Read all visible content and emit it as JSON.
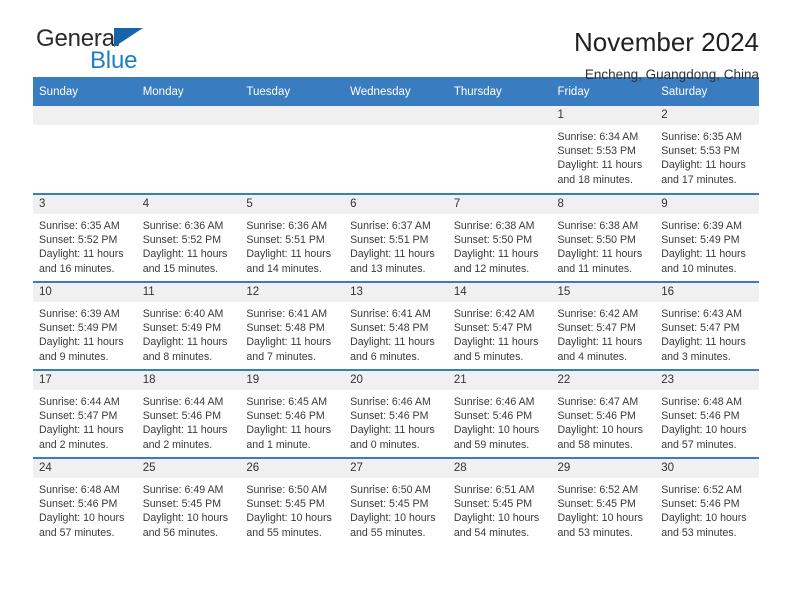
{
  "brand": {
    "name_part1": "General",
    "name_part2": "Blue",
    "mark": "triangle-logo"
  },
  "header": {
    "title": "November 2024",
    "subtitle": "Encheng, Guangdong, China"
  },
  "calendar": {
    "weekday_headers": [
      "Sunday",
      "Monday",
      "Tuesday",
      "Wednesday",
      "Thursday",
      "Friday",
      "Saturday"
    ],
    "colors": {
      "header_blue": "#3a7cc0",
      "daynum_band": "#f0f0f0",
      "brand_blue": "#1f7fc4",
      "text": "#333333"
    },
    "weeks": [
      [
        {
          "empty": true
        },
        {
          "empty": true
        },
        {
          "empty": true
        },
        {
          "empty": true
        },
        {
          "empty": true
        },
        {
          "day": "1",
          "sunrise": "Sunrise: 6:34 AM",
          "sunset": "Sunset: 5:53 PM",
          "daylight": "Daylight: 11 hours and 18 minutes."
        },
        {
          "day": "2",
          "sunrise": "Sunrise: 6:35 AM",
          "sunset": "Sunset: 5:53 PM",
          "daylight": "Daylight: 11 hours and 17 minutes."
        }
      ],
      [
        {
          "day": "3",
          "sunrise": "Sunrise: 6:35 AM",
          "sunset": "Sunset: 5:52 PM",
          "daylight": "Daylight: 11 hours and 16 minutes."
        },
        {
          "day": "4",
          "sunrise": "Sunrise: 6:36 AM",
          "sunset": "Sunset: 5:52 PM",
          "daylight": "Daylight: 11 hours and 15 minutes."
        },
        {
          "day": "5",
          "sunrise": "Sunrise: 6:36 AM",
          "sunset": "Sunset: 5:51 PM",
          "daylight": "Daylight: 11 hours and 14 minutes."
        },
        {
          "day": "6",
          "sunrise": "Sunrise: 6:37 AM",
          "sunset": "Sunset: 5:51 PM",
          "daylight": "Daylight: 11 hours and 13 minutes."
        },
        {
          "day": "7",
          "sunrise": "Sunrise: 6:38 AM",
          "sunset": "Sunset: 5:50 PM",
          "daylight": "Daylight: 11 hours and 12 minutes."
        },
        {
          "day": "8",
          "sunrise": "Sunrise: 6:38 AM",
          "sunset": "Sunset: 5:50 PM",
          "daylight": "Daylight: 11 hours and 11 minutes."
        },
        {
          "day": "9",
          "sunrise": "Sunrise: 6:39 AM",
          "sunset": "Sunset: 5:49 PM",
          "daylight": "Daylight: 11 hours and 10 minutes."
        }
      ],
      [
        {
          "day": "10",
          "sunrise": "Sunrise: 6:39 AM",
          "sunset": "Sunset: 5:49 PM",
          "daylight": "Daylight: 11 hours and 9 minutes."
        },
        {
          "day": "11",
          "sunrise": "Sunrise: 6:40 AM",
          "sunset": "Sunset: 5:49 PM",
          "daylight": "Daylight: 11 hours and 8 minutes."
        },
        {
          "day": "12",
          "sunrise": "Sunrise: 6:41 AM",
          "sunset": "Sunset: 5:48 PM",
          "daylight": "Daylight: 11 hours and 7 minutes."
        },
        {
          "day": "13",
          "sunrise": "Sunrise: 6:41 AM",
          "sunset": "Sunset: 5:48 PM",
          "daylight": "Daylight: 11 hours and 6 minutes."
        },
        {
          "day": "14",
          "sunrise": "Sunrise: 6:42 AM",
          "sunset": "Sunset: 5:47 PM",
          "daylight": "Daylight: 11 hours and 5 minutes."
        },
        {
          "day": "15",
          "sunrise": "Sunrise: 6:42 AM",
          "sunset": "Sunset: 5:47 PM",
          "daylight": "Daylight: 11 hours and 4 minutes."
        },
        {
          "day": "16",
          "sunrise": "Sunrise: 6:43 AM",
          "sunset": "Sunset: 5:47 PM",
          "daylight": "Daylight: 11 hours and 3 minutes."
        }
      ],
      [
        {
          "day": "17",
          "sunrise": "Sunrise: 6:44 AM",
          "sunset": "Sunset: 5:47 PM",
          "daylight": "Daylight: 11 hours and 2 minutes."
        },
        {
          "day": "18",
          "sunrise": "Sunrise: 6:44 AM",
          "sunset": "Sunset: 5:46 PM",
          "daylight": "Daylight: 11 hours and 2 minutes."
        },
        {
          "day": "19",
          "sunrise": "Sunrise: 6:45 AM",
          "sunset": "Sunset: 5:46 PM",
          "daylight": "Daylight: 11 hours and 1 minute."
        },
        {
          "day": "20",
          "sunrise": "Sunrise: 6:46 AM",
          "sunset": "Sunset: 5:46 PM",
          "daylight": "Daylight: 11 hours and 0 minutes."
        },
        {
          "day": "21",
          "sunrise": "Sunrise: 6:46 AM",
          "sunset": "Sunset: 5:46 PM",
          "daylight": "Daylight: 10 hours and 59 minutes."
        },
        {
          "day": "22",
          "sunrise": "Sunrise: 6:47 AM",
          "sunset": "Sunset: 5:46 PM",
          "daylight": "Daylight: 10 hours and 58 minutes."
        },
        {
          "day": "23",
          "sunrise": "Sunrise: 6:48 AM",
          "sunset": "Sunset: 5:46 PM",
          "daylight": "Daylight: 10 hours and 57 minutes."
        }
      ],
      [
        {
          "day": "24",
          "sunrise": "Sunrise: 6:48 AM",
          "sunset": "Sunset: 5:46 PM",
          "daylight": "Daylight: 10 hours and 57 minutes."
        },
        {
          "day": "25",
          "sunrise": "Sunrise: 6:49 AM",
          "sunset": "Sunset: 5:45 PM",
          "daylight": "Daylight: 10 hours and 56 minutes."
        },
        {
          "day": "26",
          "sunrise": "Sunrise: 6:50 AM",
          "sunset": "Sunset: 5:45 PM",
          "daylight": "Daylight: 10 hours and 55 minutes."
        },
        {
          "day": "27",
          "sunrise": "Sunrise: 6:50 AM",
          "sunset": "Sunset: 5:45 PM",
          "daylight": "Daylight: 10 hours and 55 minutes."
        },
        {
          "day": "28",
          "sunrise": "Sunrise: 6:51 AM",
          "sunset": "Sunset: 5:45 PM",
          "daylight": "Daylight: 10 hours and 54 minutes."
        },
        {
          "day": "29",
          "sunrise": "Sunrise: 6:52 AM",
          "sunset": "Sunset: 5:45 PM",
          "daylight": "Daylight: 10 hours and 53 minutes."
        },
        {
          "day": "30",
          "sunrise": "Sunrise: 6:52 AM",
          "sunset": "Sunset: 5:46 PM",
          "daylight": "Daylight: 10 hours and 53 minutes."
        }
      ]
    ]
  }
}
